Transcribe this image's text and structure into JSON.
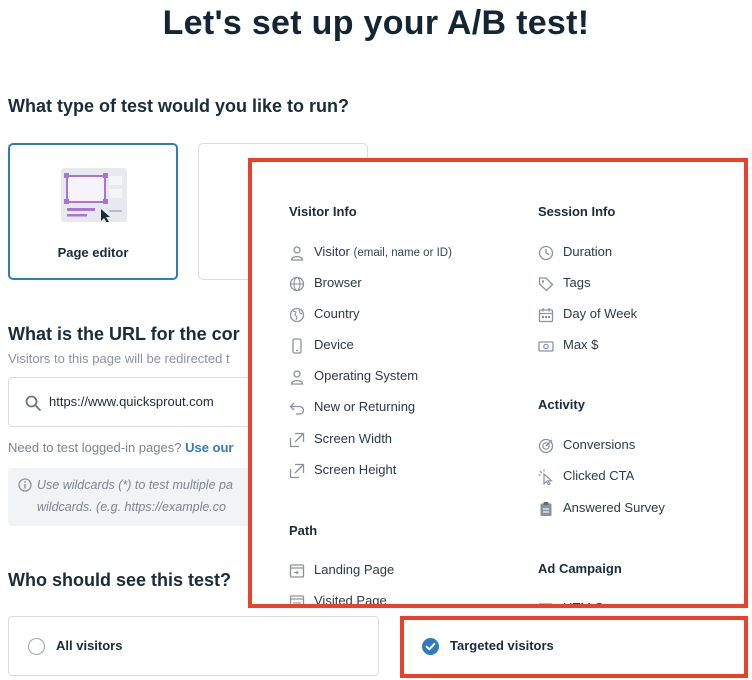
{
  "page": {
    "title": "Let's set up your A/B test!"
  },
  "test_type": {
    "heading": "What type of test would you like to run?",
    "cards": [
      {
        "label": "Page editor",
        "selected": true
      },
      {
        "label": "",
        "selected": false
      }
    ]
  },
  "url_section": {
    "heading": "What is the URL for the cor",
    "subtext": "Visitors to this page will be redirected t",
    "url_value": "https://www.quicksprout.com",
    "logged_in_note": "Need to test logged-in pages?",
    "logged_in_link": "Use our",
    "info_line1": "Use wildcards (*) to test multiple pa",
    "info_line2": "wildcards. (e.g. https://example.co"
  },
  "audience": {
    "heading": "Who should see this test?",
    "options": [
      {
        "label": "All visitors",
        "checked": false
      },
      {
        "label": "Targeted visitors",
        "checked": true
      }
    ]
  },
  "targeting_menu": {
    "visitor_info": {
      "title": "Visitor Info",
      "items": [
        {
          "label": "Visitor",
          "detail": "(email, name or ID)",
          "icon": "person-icon"
        },
        {
          "label": "Browser",
          "icon": "globe-icon"
        },
        {
          "label": "Country",
          "icon": "earth-icon"
        },
        {
          "label": "Device",
          "icon": "phone-icon"
        },
        {
          "label": "Operating System",
          "icon": "person-icon"
        },
        {
          "label": "New or Returning",
          "icon": "return-arrow-icon"
        },
        {
          "label": "Screen Width",
          "icon": "expand-icon"
        },
        {
          "label": "Screen Height",
          "icon": "expand-icon"
        }
      ]
    },
    "path": {
      "title": "Path",
      "items": [
        {
          "label": "Landing Page",
          "icon": "page-in-icon"
        },
        {
          "label": "Visited Page",
          "icon": "page-icon"
        }
      ]
    },
    "session_info": {
      "title": "Session Info",
      "items": [
        {
          "label": "Duration",
          "icon": "clock-icon"
        },
        {
          "label": "Tags",
          "icon": "tag-icon"
        },
        {
          "label": "Day of Week",
          "icon": "calendar-icon"
        },
        {
          "label": "Max $",
          "icon": "money-icon"
        }
      ]
    },
    "activity": {
      "title": "Activity",
      "items": [
        {
          "label": "Conversions",
          "icon": "target-icon"
        },
        {
          "label": "Clicked CTA",
          "icon": "pointer-click-icon"
        },
        {
          "label": "Answered Survey",
          "icon": "clipboard-icon"
        }
      ]
    },
    "ad_campaign": {
      "title": "Ad Campaign",
      "items": [
        {
          "label": "UTM Source",
          "icon": "flag-icon"
        }
      ]
    }
  },
  "colors": {
    "accent": "#2f7bbf",
    "highlight": "#e8412c",
    "text": "#1c2b39",
    "muted": "#8a939c"
  }
}
